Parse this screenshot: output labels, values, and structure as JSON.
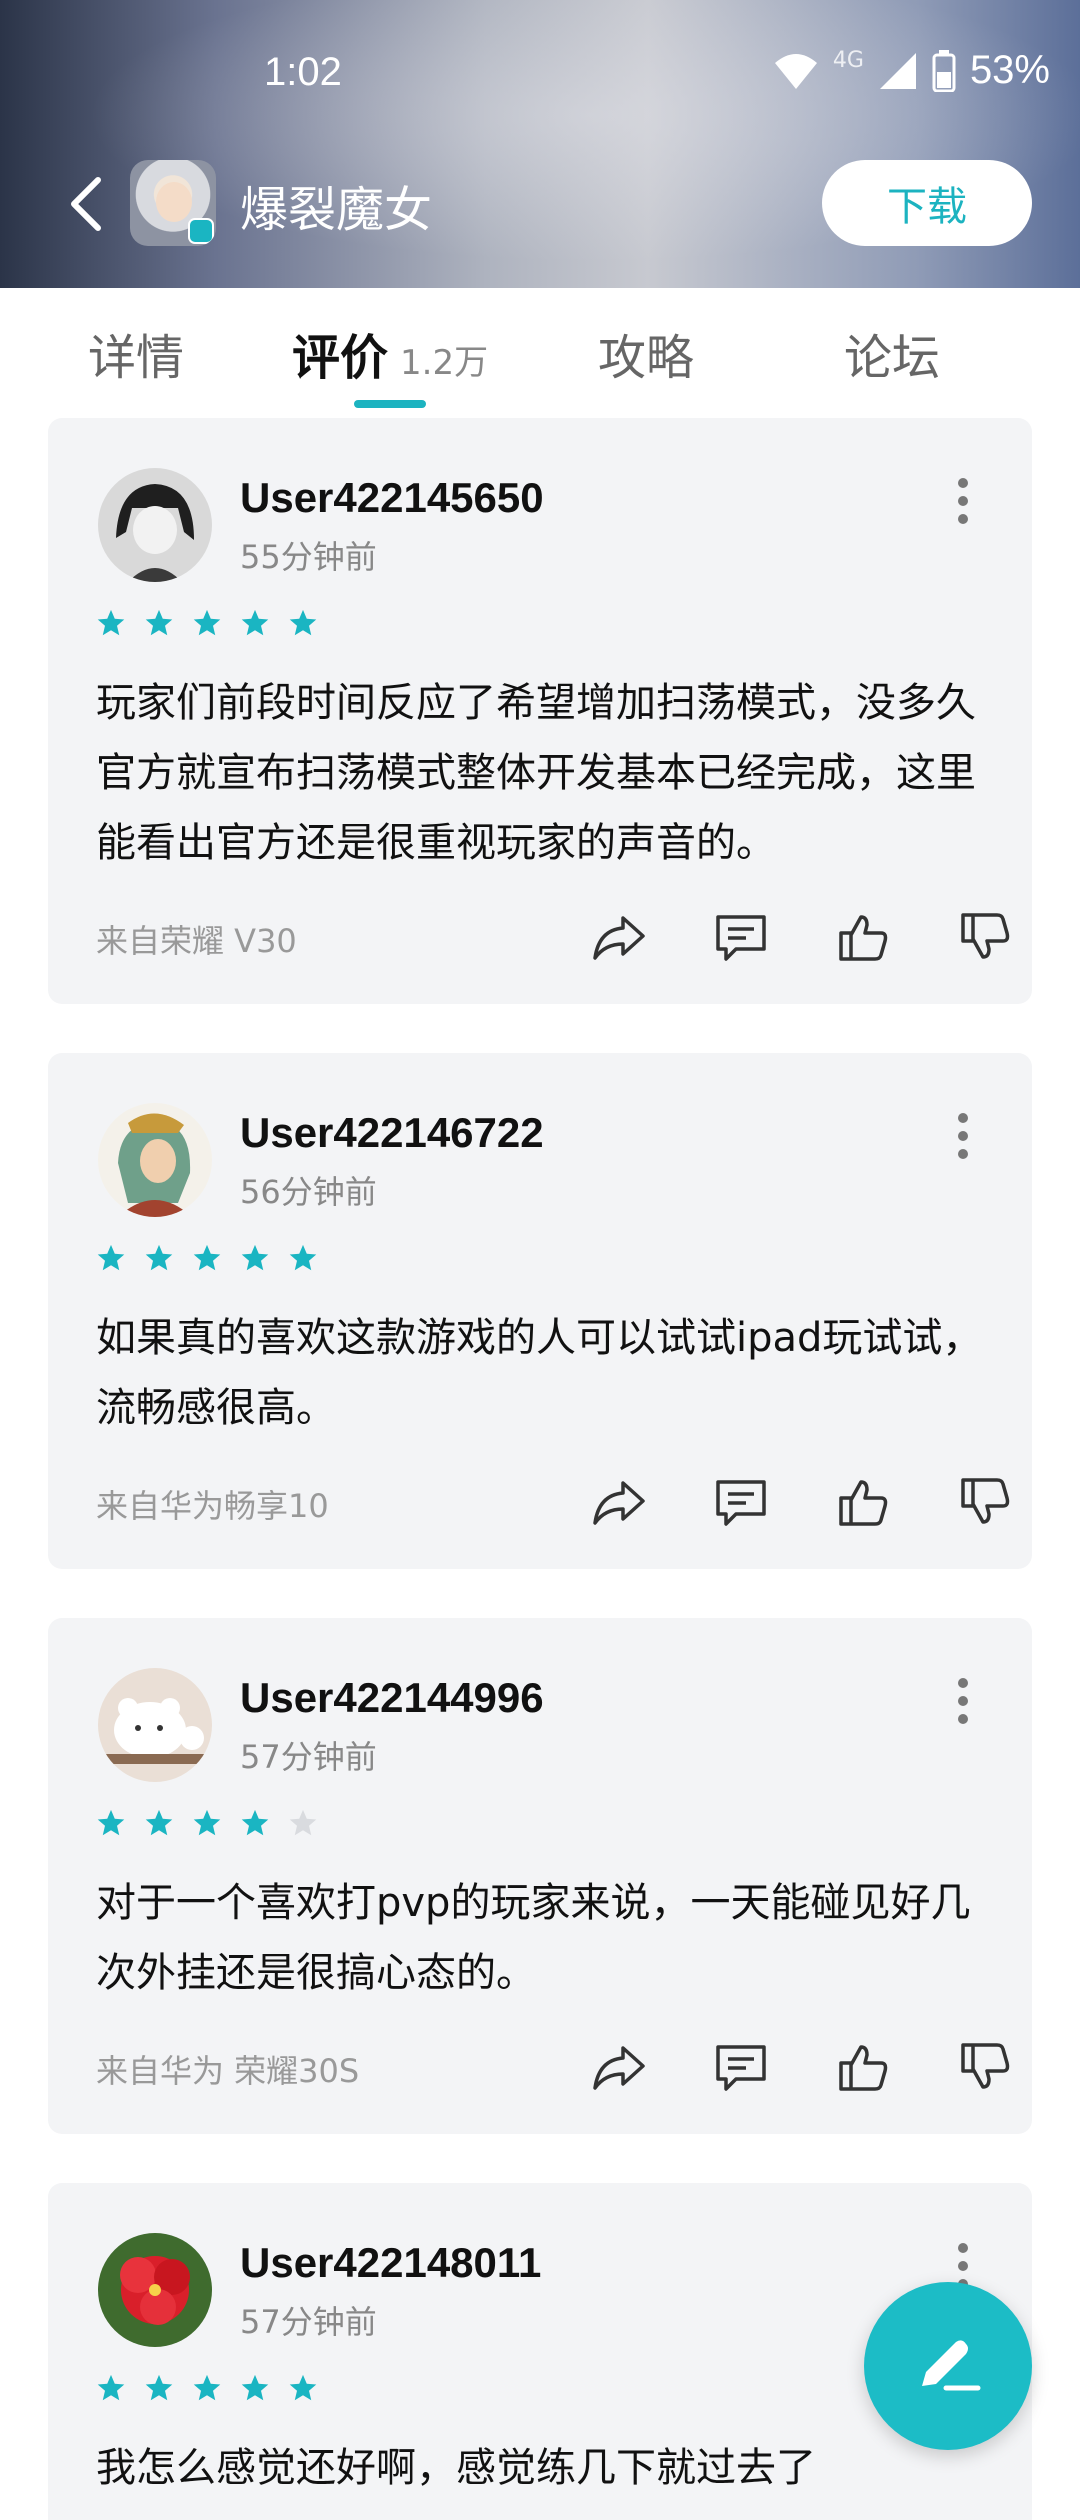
{
  "status_bar": {
    "time": "1:02",
    "network": "4G",
    "battery": "53%"
  },
  "header": {
    "app_name": "爆裂魔女",
    "download_label": "下载"
  },
  "tabs": [
    {
      "label": "详情"
    },
    {
      "label": "评价",
      "count": "1.2万"
    },
    {
      "label": "攻略"
    },
    {
      "label": "论坛"
    }
  ],
  "colors": {
    "accent": "#1cb3c0",
    "star_on": "#1ab5c2",
    "star_off": "#d9dbdf"
  },
  "reviews": [
    {
      "user": "User422145650",
      "time": "55分钟前",
      "stars": 5,
      "text": "玩家们前段时间反应了希望增加扫荡模式，没多久官方就宣布扫荡模式整体开发基本已经完成，这里能看出官方还是很重视玩家的声音的。",
      "device": "来自荣耀 V30"
    },
    {
      "user": "User422146722",
      "time": "56分钟前",
      "stars": 5,
      "text": "如果真的喜欢这款游戏的人可以试试ipad玩试试，流畅感很高。",
      "device": "来自华为畅享10"
    },
    {
      "user": "User422144996",
      "time": "57分钟前",
      "stars": 4,
      "text": "对于一个喜欢打pvp的玩家来说，一天能碰见好几次外挂还是很搞心态的。",
      "device": "来自华为 荣耀30S"
    },
    {
      "user": "User422148011",
      "time": "57分钟前",
      "stars": 5,
      "text": "我怎么感觉还好啊，感觉练几下就过去了",
      "device": ""
    }
  ]
}
